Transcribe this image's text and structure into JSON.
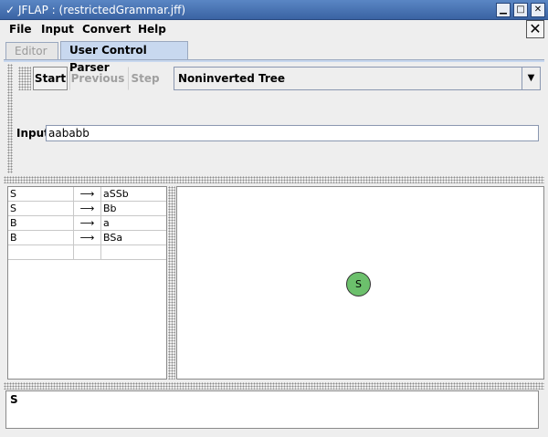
{
  "window": {
    "title": "JFLAP : (restrictedGrammar.jff)",
    "system_menu_glyph": "✓",
    "minimize_glyph": "▁",
    "maximize_glyph": "□",
    "close_glyph": "✕"
  },
  "menubar": {
    "items": [
      "File",
      "Input",
      "Convert",
      "Help"
    ],
    "close_glyph": "✕"
  },
  "tabs": [
    {
      "label": "Editor",
      "active": false
    },
    {
      "label": "User Control Parser",
      "active": true
    }
  ],
  "toolbar": {
    "start_label": "Start",
    "previous_label": "Previous",
    "step_label": "Step",
    "view_select": {
      "selected": "Noninverted Tree"
    }
  },
  "input": {
    "label": "Input",
    "value": "aababb"
  },
  "grammar": {
    "arrow": "⟶",
    "rows": [
      {
        "lhs": "S",
        "rhs": "aSSb"
      },
      {
        "lhs": "S",
        "rhs": "Bb"
      },
      {
        "lhs": "B",
        "rhs": "a"
      },
      {
        "lhs": "B",
        "rhs": "BSa"
      },
      {
        "lhs": "",
        "rhs": ""
      }
    ]
  },
  "tree": {
    "root_label": "S",
    "node_color": "#6cc06c"
  },
  "status": {
    "text": "S"
  }
}
